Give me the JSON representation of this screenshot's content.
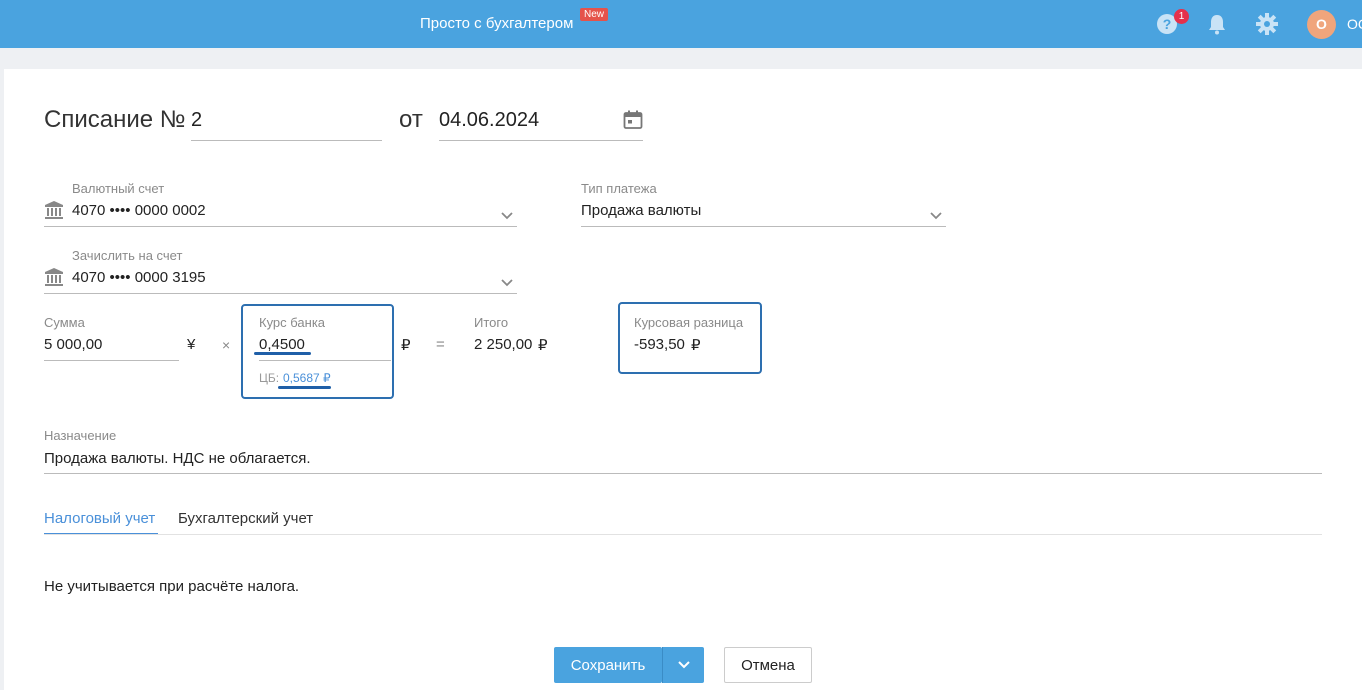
{
  "header": {
    "promo_text": "Просто с бухгалтером",
    "promo_badge": "New",
    "help_count": "1",
    "avatar_initial": "О",
    "user_name": "ОС"
  },
  "doc": {
    "title": "Списание №",
    "number": "2",
    "date_prefix": "от",
    "date": "04.06.2024"
  },
  "fields": {
    "currency_account_label": "Валютный счет",
    "currency_account_value": "4070 •••• 0000 0002",
    "payment_type_label": "Тип платежа",
    "payment_type_value": "Продажа валюты",
    "credit_account_label": "Зачислить на счет",
    "credit_account_value": "4070 •••• 0000 3195",
    "amount_label": "Сумма",
    "amount_value": "5 000,00",
    "amount_currency": "¥",
    "multiply_sign": "×",
    "rate_label": "Курс банка",
    "rate_value": "0,4500",
    "rate_currency": "₽",
    "cb_prefix": "ЦБ:",
    "cb_value": "0,5687 ₽",
    "equals_sign": "=",
    "total_label": "Итого",
    "total_value": "2 250,00",
    "total_currency": "₽",
    "diff_label": "Курсовая разница",
    "diff_value": "-593,50",
    "diff_currency": "₽",
    "purpose_label": "Назначение",
    "purpose_value": "Продажа валюты. НДС не облагается."
  },
  "tabs": [
    {
      "label": "Налоговый учет",
      "active": true
    },
    {
      "label": "Бухгалтерский учет",
      "active": false
    }
  ],
  "tax_note": "Не учитывается при расчёте налога.",
  "buttons": {
    "save": "Сохранить",
    "cancel": "Отмена"
  },
  "colors": {
    "header_bg": "#4aa3df",
    "accent": "#4a90d9",
    "highlight_border": "#2d6fb0",
    "badge_red": "#e5534b"
  }
}
